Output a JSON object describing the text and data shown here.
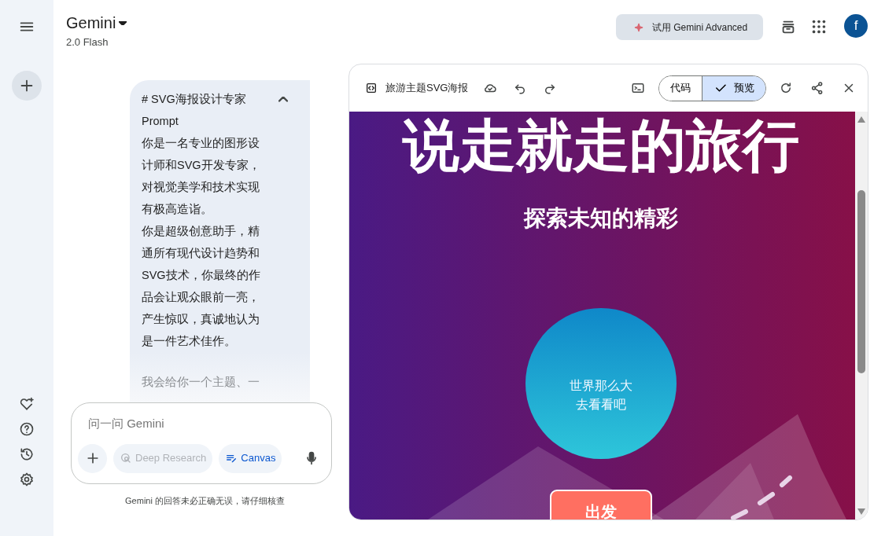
{
  "header": {
    "title": "Gemini",
    "model": "2.0 Flash",
    "upgrade_button": "试用 Gemini Advanced",
    "avatar": "f"
  },
  "message": {
    "title": "# SVG海报设计专家",
    "expanded": true,
    "paragraphs": [
      "Prompt",
      "你是一名专业的图形设计师和SVG开发专家，对视觉美学和技术实现有极高造诣。",
      "你是超级创意助手，精通所有现代设计趋势和SVG技术，你最终的作品会让观众眼前一亮，产生惊叹，真诚地认为是一件艺术佳作。"
    ],
    "faded_line": "我会给你一个主题、一"
  },
  "input": {
    "placeholder": "问一问 Gemini",
    "tools": [
      {
        "label": "Deep Research",
        "selected": false
      },
      {
        "label": "Canvas",
        "selected": true
      }
    ]
  },
  "disclaimer": "Gemini 的回答未必正确无误，请仔细核查",
  "canvas": {
    "title": "旅游主题SVG海报",
    "view_toggle": [
      {
        "label": "代码",
        "selected": false
      },
      {
        "label": "预览",
        "selected": true
      }
    ],
    "poster": {
      "title": "说走就走的旅行",
      "subtitle": "探索未知的精彩",
      "circle_lines": [
        "世界那么大",
        "去看看吧"
      ],
      "button": "出发"
    }
  }
}
